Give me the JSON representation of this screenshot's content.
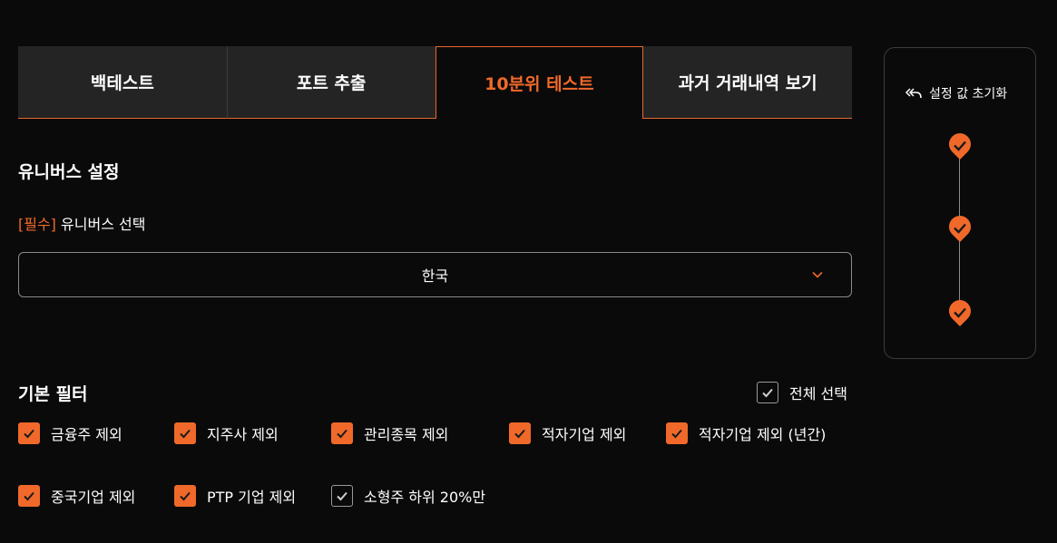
{
  "tabs": [
    {
      "label": "백테스트",
      "active": false
    },
    {
      "label": "포트 추출",
      "active": false
    },
    {
      "label": "10분위 테스트",
      "active": true
    },
    {
      "label": "과거 거래내역 보기",
      "active": false
    }
  ],
  "universe": {
    "title": "유니버스 설정",
    "required_tag": "[필수]",
    "field_label": "유니버스 선택",
    "selected": "한국"
  },
  "basic_filter": {
    "title": "기본 필터",
    "select_all_label": "전체 선택",
    "select_all_checked": false,
    "options": [
      {
        "label": "금융주 제외",
        "checked": true
      },
      {
        "label": "지주사 제외",
        "checked": true
      },
      {
        "label": "관리종목 제외",
        "checked": true
      },
      {
        "label": "적자기업 제외",
        "checked": true
      },
      {
        "label": "적자기업 제외 (년간)",
        "checked": true
      },
      {
        "label": "중국기업 제외",
        "checked": true
      },
      {
        "label": "PTP 기업 제외",
        "checked": true
      },
      {
        "label": "소형주 하위 20%만",
        "checked": false
      }
    ]
  },
  "side_panel": {
    "reset_label": "설정 값 초기화",
    "reset_icon": "reply-all-icon",
    "steps": [
      "step-check-icon",
      "step-check-icon",
      "step-check-icon"
    ]
  },
  "colors": {
    "accent": "#f0692a",
    "background": "#0a0a0a",
    "tab_bg": "#242424"
  }
}
